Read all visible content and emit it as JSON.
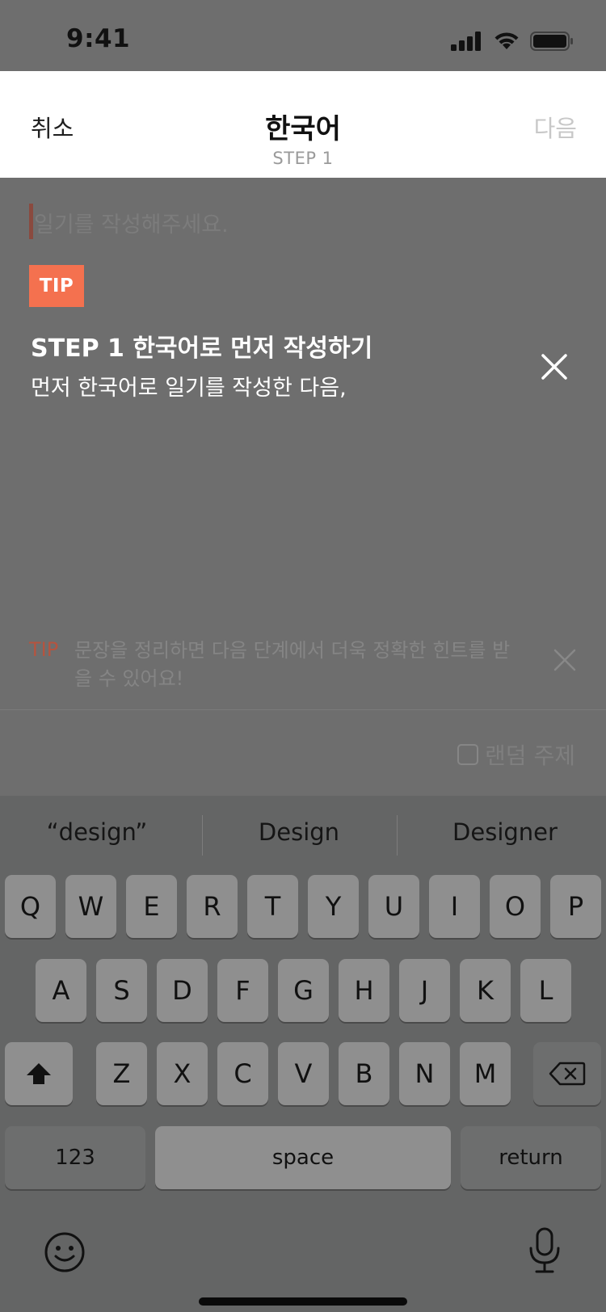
{
  "status_bar": {
    "time": "9:41"
  },
  "header": {
    "cancel_label": "취소",
    "title": "한국어",
    "step": "STEP 1",
    "next_label": "다음"
  },
  "editor": {
    "placeholder": "일기를 작성해주세요."
  },
  "tip_overlay": {
    "badge": "TIP",
    "title": "STEP 1 한국어로 먼저 작성하기",
    "description": "먼저 한국어로 일기를 작성한 다음,"
  },
  "hint": {
    "label": "TIP",
    "text": "문장을 정리하면 다음 단계에서 더욱 정확한 힌트를 받을 수 있어요!"
  },
  "random_topic": {
    "label": "랜덤 주제",
    "checked": false
  },
  "keyboard": {
    "suggestions": [
      "“design”",
      "Design",
      "Designer"
    ],
    "row1": [
      "Q",
      "W",
      "E",
      "R",
      "T",
      "Y",
      "U",
      "I",
      "O",
      "P"
    ],
    "row2": [
      "A",
      "S",
      "D",
      "F",
      "G",
      "H",
      "J",
      "K",
      "L"
    ],
    "row3": [
      "Z",
      "X",
      "C",
      "V",
      "B",
      "N",
      "M"
    ],
    "numbers_label": "123",
    "space_label": "space",
    "return_label": "return"
  },
  "colors": {
    "accent": "#f4714f",
    "overlay": "#6e6e6e",
    "keyboard": "#646565"
  }
}
